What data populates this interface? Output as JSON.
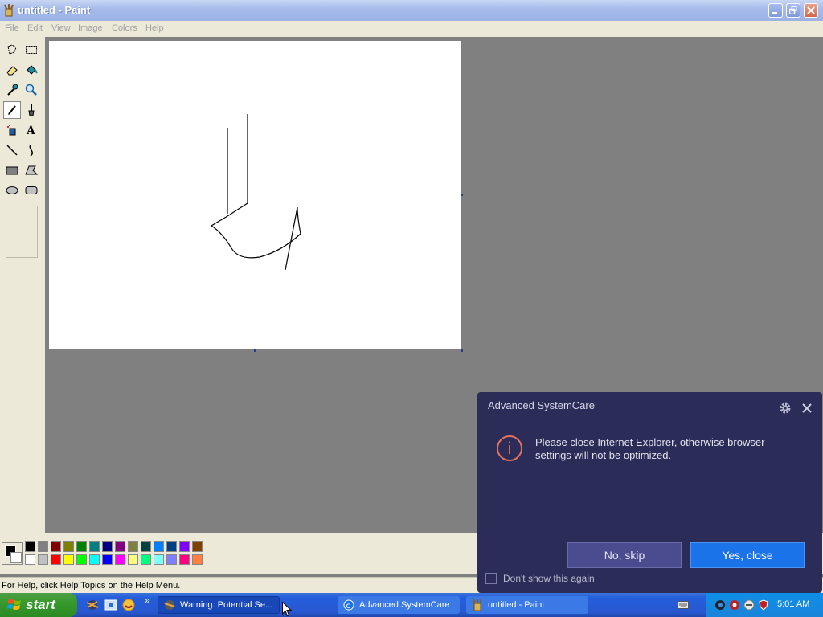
{
  "window": {
    "title": "untitled - Paint"
  },
  "menu": [
    "File",
    "Edit",
    "View",
    "Image",
    "Colors",
    "Help"
  ],
  "tools": [
    "free-form-select",
    "select",
    "eraser",
    "fill-with-color",
    "pick-color",
    "magnifier",
    "pencil",
    "brush",
    "airbrush",
    "text",
    "line",
    "curve",
    "rectangle",
    "polygon",
    "ellipse",
    "rounded-rectangle"
  ],
  "palette": {
    "top": [
      "#000000",
      "#808080",
      "#800000",
      "#808000",
      "#008000",
      "#008080",
      "#000080",
      "#800080",
      "#808040",
      "#004040",
      "#0080ff",
      "#004080",
      "#8000ff",
      "#804000"
    ],
    "bottom": [
      "#ffffff",
      "#c0c0c0",
      "#ff0000",
      "#ffff00",
      "#00ff00",
      "#00ffff",
      "#0000ff",
      "#ff00ff",
      "#ffff80",
      "#00ff80",
      "#80ffff",
      "#8080ff",
      "#ff0080",
      "#ff8040"
    ]
  },
  "status": {
    "text": "For Help, click Help Topics on the Help Menu."
  },
  "dialog": {
    "title": "Advanced SystemCare",
    "info_symbol": "i",
    "message": "Please close Internet Explorer, otherwise browser settings will not be optimized.",
    "skip_label": "No, skip",
    "yes_label": "Yes, close",
    "checkbox_label": "Don't show this again"
  },
  "taskbar": {
    "start_label": "start",
    "chevron": "»",
    "tasks": [
      "Warning: Potential Se...",
      "Advanced SystemCare",
      "untitled - Paint"
    ],
    "clock": "5:01 AM"
  }
}
